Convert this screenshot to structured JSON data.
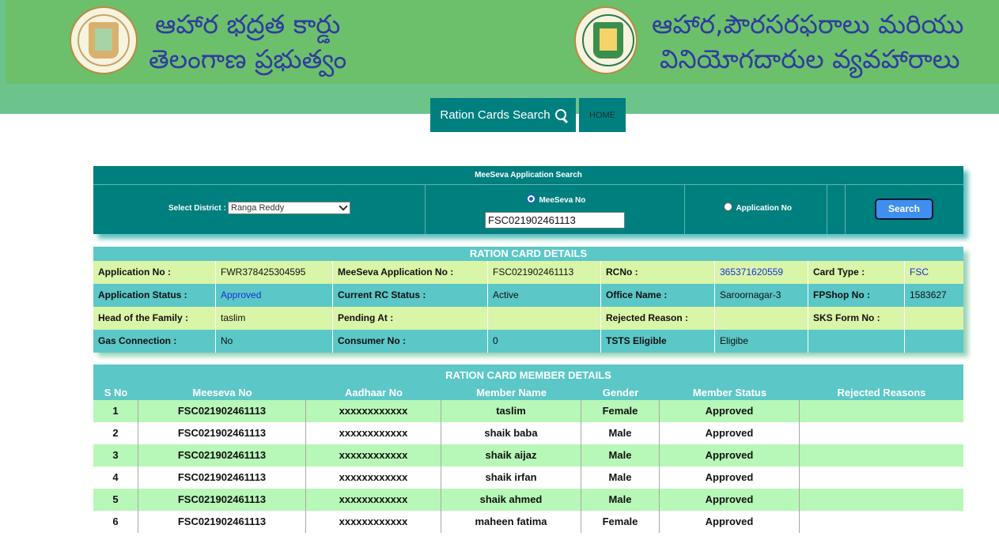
{
  "header": {
    "left_title_1": "ఆహార భద్రత కార్డు",
    "left_title_2": "తెలంగాణ ప్రభుత్వం",
    "right_title_1": "ఆహార,పౌరసరఫరాలు మరియు",
    "right_title_2": "వినియోగదారుల వ్యవహారాలు",
    "left_emblem": "telangana-government-emblem",
    "right_emblem": "tscscl-logo"
  },
  "nav": {
    "search_label": "Ration Cards Search",
    "search_icon": "search-icon",
    "home_label": "HOME"
  },
  "meeseva_search": {
    "title": "MeeSeva Application Search",
    "district_label": "Select District :",
    "district_value": "Ranga Reddy",
    "radio_meeseva_label": "MeeSeva No",
    "radio_meeseva_selected": true,
    "input_value": "FSC021902461113",
    "radio_application_label": "Application No",
    "radio_application_selected": false,
    "search_button": "Search"
  },
  "ration_card_details": {
    "title": "RATION CARD DETAILS",
    "rows": [
      [
        "Application No :",
        "FWR378425304595",
        "MeeSeva Application No :",
        "FSC021902461113",
        "RCNo :",
        "365371620559",
        "Card Type :",
        "FSC"
      ],
      [
        "Application Status :",
        "Approved",
        "Current RC Status :",
        "Active",
        "Office Name :",
        "Saroornagar-3",
        "FPShop No :",
        "1583627"
      ],
      [
        "Head of the Family :",
        "taslim",
        "Pending At :",
        "",
        "Rejected Reason :",
        "",
        "SKS Form No :",
        ""
      ],
      [
        "Gas Connection :",
        "No",
        "Consumer No :",
        "0",
        "TSTS Eligible",
        "Eligibe",
        "",
        ""
      ]
    ]
  },
  "member_details": {
    "title": "RATION CARD MEMBER DETAILS",
    "columns": [
      "S No",
      "Meeseva No",
      "Aadhaar No",
      "Member Name",
      "Gender",
      "Member Status",
      "Rejected Reasons"
    ],
    "rows": [
      [
        "1",
        "FSC021902461113",
        "xxxxxxxxxxxx",
        "taslim",
        "Female",
        "Approved",
        ""
      ],
      [
        "2",
        "FSC021902461113",
        "xxxxxxxxxxxx",
        "shaik baba",
        "Male",
        "Approved",
        ""
      ],
      [
        "3",
        "FSC021902461113",
        "xxxxxxxxxxxx",
        "shaik aijaz",
        "Male",
        "Approved",
        ""
      ],
      [
        "4",
        "FSC021902461113",
        "xxxxxxxxxxxx",
        "shaik irfan",
        "Male",
        "Approved",
        ""
      ],
      [
        "5",
        "FSC021902461113",
        "xxxxxxxxxxxx",
        "shaik ahmed",
        "Male",
        "Approved",
        ""
      ],
      [
        "6",
        "FSC021902461113",
        "xxxxxxxxxxxx",
        "maheen fatima",
        "Female",
        "Approved",
        ""
      ]
    ]
  },
  "colors": {
    "header_green": "#6cc06c",
    "teal": "#007f7f",
    "light_teal": "#5bc7c7",
    "light_green_row": "#d9f5a8",
    "member_row_green": "#b7f7b7",
    "telugu_text": "#2f3c9e",
    "link_blue": "#1a2fd6"
  }
}
